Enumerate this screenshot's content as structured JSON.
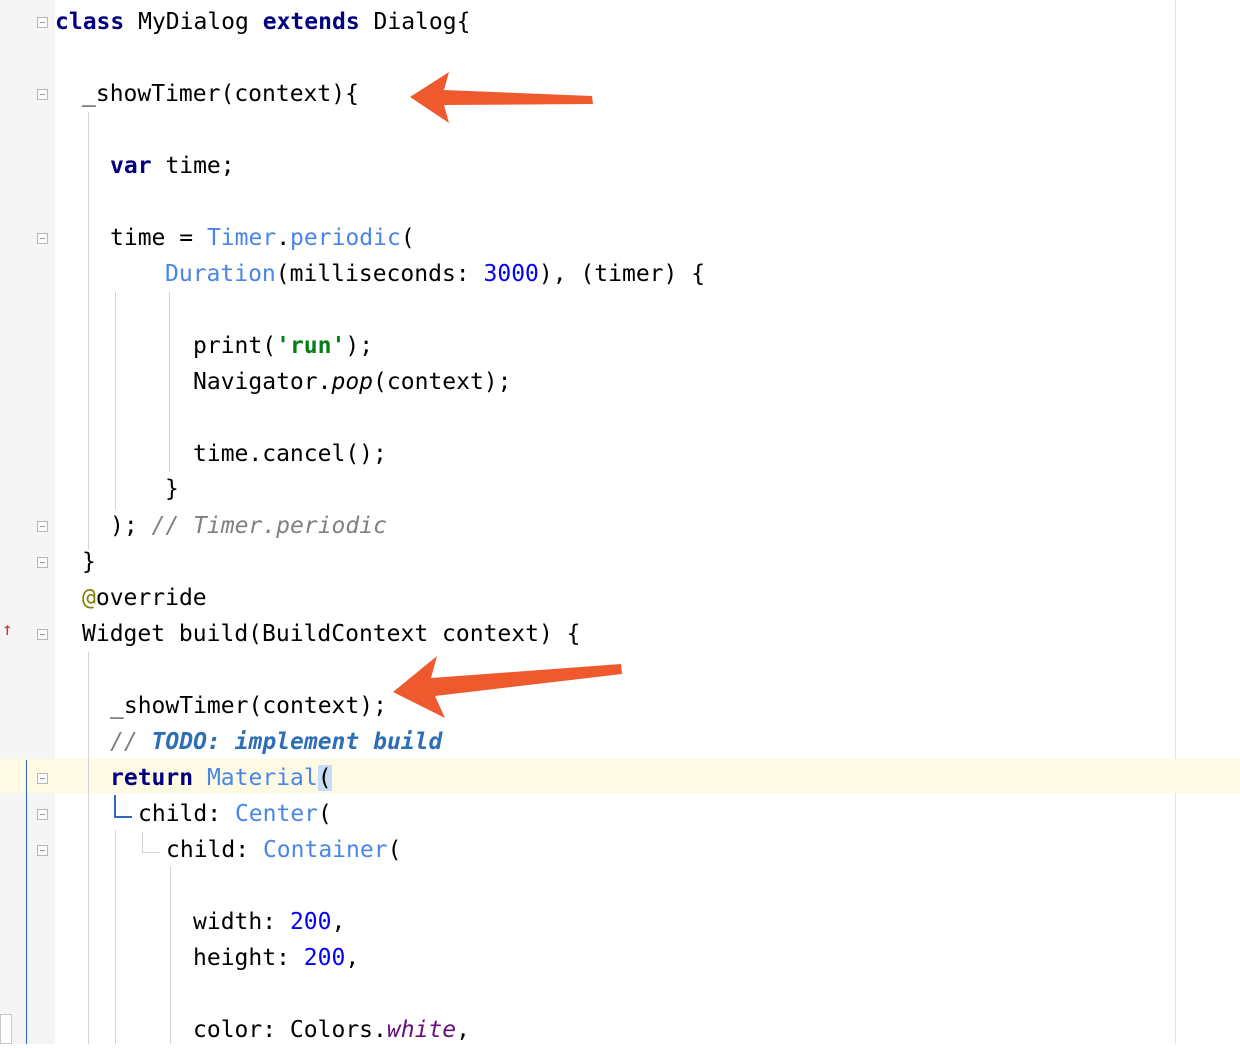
{
  "editor": {
    "lines": [
      {
        "id": "l1",
        "tokens": [
          {
            "t": "class",
            "c": "kw"
          },
          {
            "t": " MyDialog "
          },
          {
            "t": "extends",
            "c": "kw"
          },
          {
            "t": " Dialog{"
          }
        ]
      },
      {
        "id": "l2",
        "tokens": [
          {
            "t": "_showTimer(context){"
          }
        ]
      },
      {
        "id": "l3",
        "tokens": [
          {
            "t": "var",
            "c": "kw"
          },
          {
            "t": " time;"
          }
        ]
      },
      {
        "id": "l4",
        "tokens": [
          {
            "t": "time = "
          },
          {
            "t": "Timer",
            "c": "type"
          },
          {
            "t": "."
          },
          {
            "t": "periodic",
            "c": "type"
          },
          {
            "t": "("
          }
        ]
      },
      {
        "id": "l5",
        "tokens": [
          {
            "t": "Duration",
            "c": "type"
          },
          {
            "t": "(milliseconds: "
          },
          {
            "t": "3000",
            "c": "num"
          },
          {
            "t": "), (timer) {"
          }
        ]
      },
      {
        "id": "l6",
        "tokens": [
          {
            "t": "print("
          },
          {
            "t": "'run'",
            "c": "str"
          },
          {
            "t": ");"
          }
        ]
      },
      {
        "id": "l7",
        "tokens": [
          {
            "t": "Navigator."
          },
          {
            "t": "pop",
            "c": "fn-italic"
          },
          {
            "t": "(context);"
          }
        ]
      },
      {
        "id": "l8",
        "tokens": [
          {
            "t": "time.cancel();"
          }
        ]
      },
      {
        "id": "l9",
        "tokens": [
          {
            "t": "}"
          }
        ]
      },
      {
        "id": "l10",
        "tokens": [
          {
            "t": "); "
          },
          {
            "t": "// Timer.periodic",
            "c": "cmt"
          }
        ]
      },
      {
        "id": "l11",
        "tokens": [
          {
            "t": "}"
          }
        ]
      },
      {
        "id": "l12",
        "tokens": [
          {
            "t": "@",
            "c": "ann"
          },
          {
            "t": "override"
          }
        ]
      },
      {
        "id": "l13",
        "tokens": [
          {
            "t": "Widget build(BuildContext context) {"
          }
        ]
      },
      {
        "id": "l14",
        "tokens": [
          {
            "t": "_showTimer(context);"
          }
        ]
      },
      {
        "id": "l15",
        "tokens": [
          {
            "t": "// ",
            "c": "cmt"
          },
          {
            "t": "TODO: implement build",
            "c": "todo"
          }
        ]
      },
      {
        "id": "l16",
        "tokens": [
          {
            "t": "return",
            "c": "kw"
          },
          {
            "t": " "
          },
          {
            "t": "Material",
            "c": "type"
          },
          {
            "t": "(",
            "c": "bracket-hl"
          }
        ]
      },
      {
        "id": "l17",
        "tokens": [
          {
            "t": "child: "
          },
          {
            "t": "Center",
            "c": "type"
          },
          {
            "t": "("
          }
        ]
      },
      {
        "id": "l18",
        "tokens": [
          {
            "t": "child: "
          },
          {
            "t": "Container",
            "c": "type"
          },
          {
            "t": "("
          }
        ]
      },
      {
        "id": "l19",
        "tokens": [
          {
            "t": "width: "
          },
          {
            "t": "200",
            "c": "num"
          },
          {
            "t": ","
          }
        ]
      },
      {
        "id": "l20",
        "tokens": [
          {
            "t": "height: "
          },
          {
            "t": "200",
            "c": "num"
          },
          {
            "t": ","
          }
        ]
      },
      {
        "id": "l21",
        "tokens": [
          {
            "t": "color: Colors."
          },
          {
            "t": "white",
            "c": "field"
          },
          {
            "t": ","
          }
        ]
      }
    ]
  },
  "gutter": {
    "override_marker_icon": "override-up-arrow-icon",
    "fold_icon": "fold-marker-icon"
  },
  "annotations": {
    "arrow_color": "#ee5a2e",
    "arrow_icon": "red-arrow-icon"
  }
}
